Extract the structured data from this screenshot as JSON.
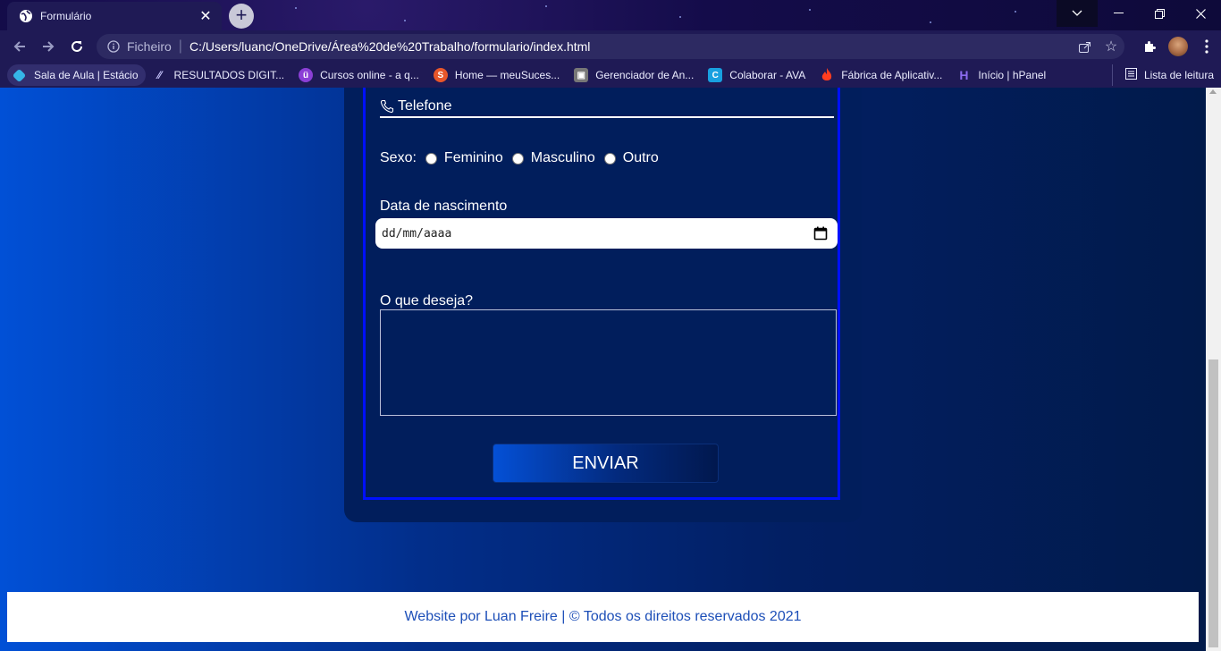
{
  "browser": {
    "tab_title": "Formulário",
    "omnibox_scheme": "Ficheiro",
    "omnibox_url": "C:/Users/luanc/OneDrive/Área%20de%20Trabalho/formulario/index.html",
    "bookmarks": [
      {
        "label": "Sala de Aula | Estácio",
        "icon": "diamond-icon",
        "color": "#35b6e8"
      },
      {
        "label": "RESULTADOS DIGIT...",
        "icon": "slashes-icon",
        "color": "#1f1a55"
      },
      {
        "label": "Cursos online - a q...",
        "icon": "udemy-icon",
        "color": "#8b3fd6"
      },
      {
        "label": "Home — meuSuces...",
        "icon": "s-logo-icon",
        "color": "#e8562a"
      },
      {
        "label": "Gerenciador de An...",
        "icon": "printer-icon",
        "color": "#777777"
      },
      {
        "label": "Colaborar - AVA",
        "icon": "c-logo-icon",
        "color": "#18a0e0"
      },
      {
        "label": "Fábrica de Aplicativ...",
        "icon": "flame-icon",
        "color": "#ff3d1f"
      },
      {
        "label": "Início | hPanel",
        "icon": "h-logo-icon",
        "color": "#673de6"
      }
    ],
    "reading_list": "Lista de leitura"
  },
  "form": {
    "telefone_label": "Telefone",
    "sexo_label": "Sexo:",
    "sexo_options": [
      "Feminino",
      "Masculino",
      "Outro"
    ],
    "data_label": "Data de nascimento",
    "data_placeholder": "dd/mm/aaaa",
    "desejo_label": "O que deseja?",
    "desejo_value": "",
    "submit_label": "ENVIAR"
  },
  "footer": {
    "text": "Website por Luan Freire | © Todos os direitos reservados 2021"
  },
  "colors": {
    "page_gradient_start": "#0150d6",
    "page_gradient_end": "#011a4a",
    "card_bg": "#011e5c",
    "fieldset_border": "#0010ff",
    "footer_text": "#1d4fb8"
  }
}
